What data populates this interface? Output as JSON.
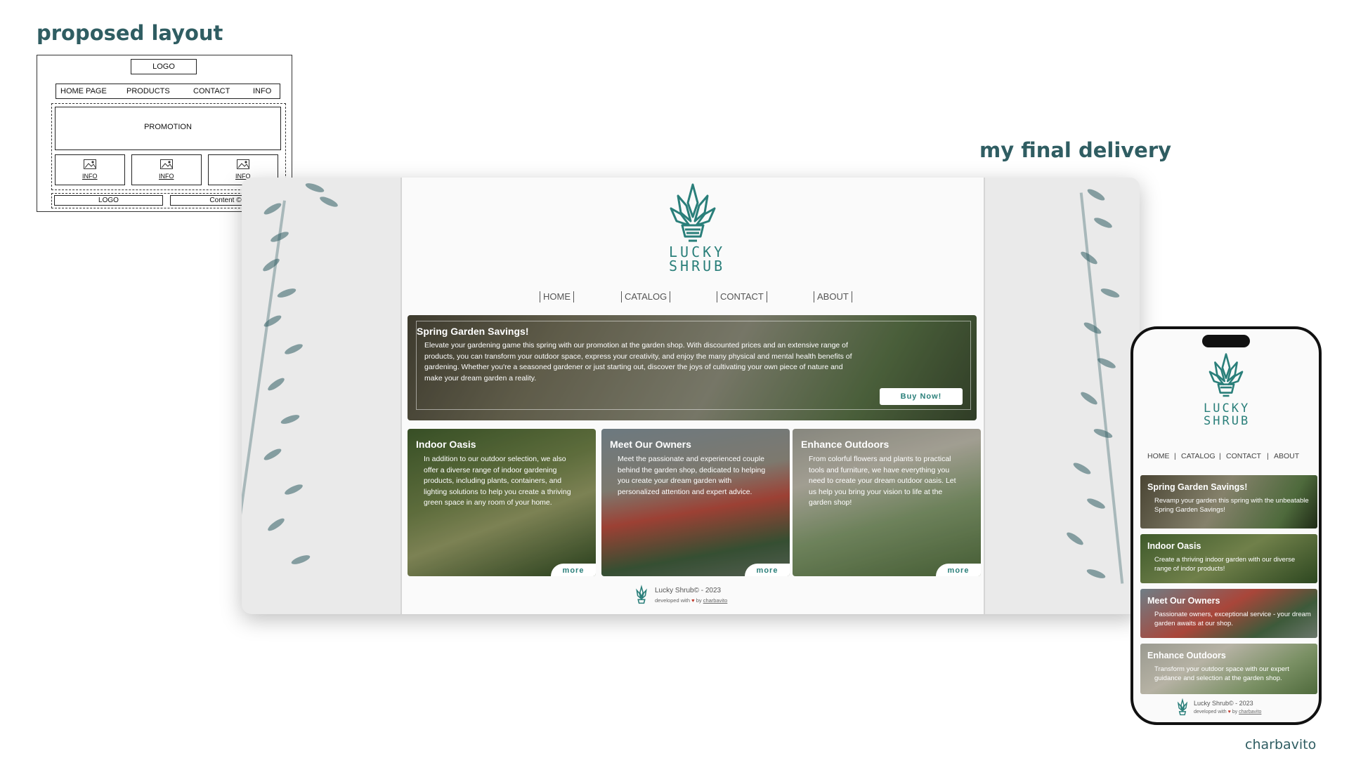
{
  "headings": {
    "proposed": "proposed layout",
    "final": "my final delivery"
  },
  "wireframe": {
    "logo": "LOGO",
    "nav": [
      "HOME PAGE",
      "PRODUCTS",
      "CONTACT",
      "INFO"
    ],
    "promotion": "PROMOTION",
    "info": [
      "INFO",
      "INFO",
      "INFO"
    ],
    "footer_logo": "LOGO",
    "footer_content": "Content ©"
  },
  "site": {
    "brand_line1": "LUCKY",
    "brand_line2": "SHRUB",
    "nav": [
      "HOME",
      "CATALOG",
      "CONTACT",
      "ABOUT"
    ],
    "promo": {
      "title": "Spring Garden Savings!",
      "text": "Elevate your gardening game this spring with our promotion at the garden shop. With discounted prices and an extensive range of products, you can transform your outdoor space, express your creativity, and enjoy the many physical and mental health benefits of gardening. Whether you're a seasoned gardener or just starting out, discover the joys of cultivating your own piece of nature and make your dream garden a reality.",
      "button": "Buy Now!"
    },
    "cards": [
      {
        "title": "Indoor Oasis",
        "text": "In addition to our outdoor selection, we also offer a diverse range of indoor gardening products, including plants, containers, and lighting solutions to help you create a thriving green space in any room of your home.",
        "more": "more"
      },
      {
        "title": "Meet Our Owners",
        "text": "Meet the passionate and experienced couple behind the garden shop, dedicated to helping you create your dream garden with personalized attention and expert advice.",
        "more": "more"
      },
      {
        "title": "Enhance Outdoors",
        "text": "From colorful flowers and plants to practical tools and furniture, we have everything you need to create your dream outdoor oasis. Let us help you bring your vision to life at the garden shop!",
        "more": "more"
      }
    ],
    "footer": {
      "copyright": "Lucky Shrub© - 2023",
      "dev_prefix": "developed with",
      "dev_by": "by",
      "dev_author": "charbavito"
    }
  },
  "mobile": {
    "nav": [
      "HOME",
      "CATALOG",
      "CONTACT",
      "ABOUT"
    ],
    "cards": [
      {
        "title": "Spring Garden Savings!",
        "text": "Revamp your garden this spring with the unbeatable Spring Garden Savings!"
      },
      {
        "title": "Indoor Oasis",
        "text": "Create a thriving indoor garden with our diverse range of indor products!"
      },
      {
        "title": "Meet Our Owners",
        "text": "Passionate owners, exceptional service - your dream garden awaits at our shop."
      },
      {
        "title": "Enhance Outdoors",
        "text": "Transform your outdoor space with our expert guidance and selection at the garden shop."
      }
    ]
  },
  "signature": "charbavito",
  "colors": {
    "brand_teal": "#2a7f7a",
    "heading": "#2f5d62",
    "heart": "#c0392b"
  },
  "icons": [
    "shrub-logo-icon",
    "image-placeholder-icon",
    "heart-icon",
    "leaf-decoration"
  ]
}
